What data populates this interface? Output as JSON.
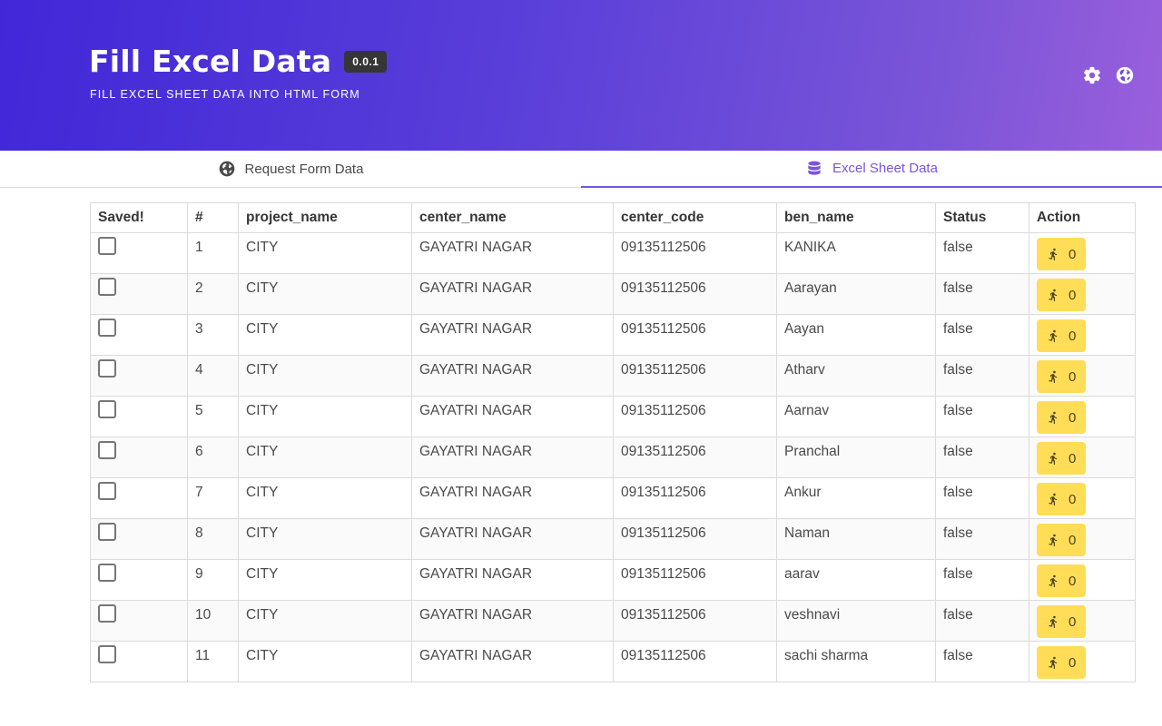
{
  "header": {
    "title": "Fill Excel Data",
    "version": "0.0.1",
    "subtitle": "FILL EXCEL SHEET DATA INTO HTML FORM",
    "icons": [
      "gear-icon",
      "globe-icon"
    ]
  },
  "tabs": [
    {
      "label": "Request Form Data",
      "icon": "globe-icon",
      "active": false
    },
    {
      "label": "Excel Sheet Data",
      "icon": "database-icon",
      "active": true
    }
  ],
  "colors": {
    "accent": "#7a55d8",
    "gradient_start": "#4127d8",
    "gradient_end": "#9a5fdc",
    "action_button": "#ffdd57"
  },
  "table": {
    "columns": [
      "Saved!",
      "#",
      "project_name",
      "center_name",
      "center_code",
      "ben_name",
      "Status",
      "Action"
    ],
    "rows": [
      {
        "num": "1",
        "project_name": "CITY",
        "center_name": "GAYATRI NAGAR",
        "center_code": "09135112506",
        "ben_name": "KANIKA",
        "status": "false",
        "action_count": "0",
        "saved": false
      },
      {
        "num": "2",
        "project_name": "CITY",
        "center_name": "GAYATRI NAGAR",
        "center_code": "09135112506",
        "ben_name": "Aarayan",
        "status": "false",
        "action_count": "0",
        "saved": false
      },
      {
        "num": "3",
        "project_name": "CITY",
        "center_name": "GAYATRI NAGAR",
        "center_code": "09135112506",
        "ben_name": "Aayan",
        "status": "false",
        "action_count": "0",
        "saved": false
      },
      {
        "num": "4",
        "project_name": "CITY",
        "center_name": "GAYATRI NAGAR",
        "center_code": "09135112506",
        "ben_name": "Atharv",
        "status": "false",
        "action_count": "0",
        "saved": false
      },
      {
        "num": "5",
        "project_name": "CITY",
        "center_name": "GAYATRI NAGAR",
        "center_code": "09135112506",
        "ben_name": "Aarnav",
        "status": "false",
        "action_count": "0",
        "saved": false
      },
      {
        "num": "6",
        "project_name": "CITY",
        "center_name": "GAYATRI NAGAR",
        "center_code": "09135112506",
        "ben_name": "Pranchal",
        "status": "false",
        "action_count": "0",
        "saved": false
      },
      {
        "num": "7",
        "project_name": "CITY",
        "center_name": "GAYATRI NAGAR",
        "center_code": "09135112506",
        "ben_name": "Ankur",
        "status": "false",
        "action_count": "0",
        "saved": false
      },
      {
        "num": "8",
        "project_name": "CITY",
        "center_name": "GAYATRI NAGAR",
        "center_code": "09135112506",
        "ben_name": "Naman",
        "status": "false",
        "action_count": "0",
        "saved": false
      },
      {
        "num": "9",
        "project_name": "CITY",
        "center_name": "GAYATRI NAGAR",
        "center_code": "09135112506",
        "ben_name": "aarav",
        "status": "false",
        "action_count": "0",
        "saved": false
      },
      {
        "num": "10",
        "project_name": "CITY",
        "center_name": "GAYATRI NAGAR",
        "center_code": "09135112506",
        "ben_name": "veshnavi",
        "status": "false",
        "action_count": "0",
        "saved": false
      },
      {
        "num": "11",
        "project_name": "CITY",
        "center_name": "GAYATRI NAGAR",
        "center_code": "09135112506",
        "ben_name": "sachi sharma",
        "status": "false",
        "action_count": "0",
        "saved": false
      }
    ]
  }
}
